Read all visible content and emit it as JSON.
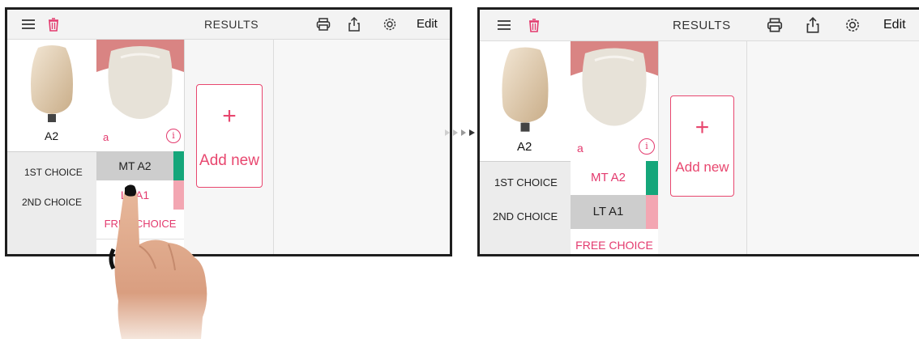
{
  "screens": [
    {
      "header": {
        "title": "RESULTS",
        "edit_label": "Edit"
      },
      "columns": [
        {
          "tooth_label": "A2"
        },
        {
          "sub_label": "a",
          "info_glyph": "i"
        }
      ],
      "row_labels": [
        "1ST CHOICE",
        "2ND CHOICE"
      ],
      "choices": {
        "first": "MT A2",
        "second": "LT A1",
        "free": "FREE CHOICE"
      },
      "add_new": {
        "plus": "+",
        "label": "Add new"
      }
    },
    {
      "header": {
        "title": "RESULTS",
        "edit_label": "Edit"
      },
      "columns": [
        {
          "tooth_label": "A2"
        },
        {
          "sub_label": "a",
          "info_glyph": "i"
        }
      ],
      "row_labels": [
        "1ST CHOICE",
        "2ND CHOICE"
      ],
      "choices": {
        "first": "MT A2",
        "second": "LT A1",
        "free": "FREE CHOICE"
      },
      "add_new": {
        "plus": "+",
        "label": "Add new"
      }
    }
  ],
  "colors": {
    "accent_pink": "#e33a6e",
    "green_marker": "#15a67a",
    "pink_marker": "#f3a6b2",
    "selected_gray": "#cdcdcd",
    "frame": "#1e1e1e"
  },
  "icons": [
    "menu-icon",
    "trash-icon",
    "print-icon",
    "share-icon",
    "gear-icon",
    "info-icon",
    "plus-icon",
    "transition-arrows-icon",
    "pointing-hand-icon"
  ]
}
